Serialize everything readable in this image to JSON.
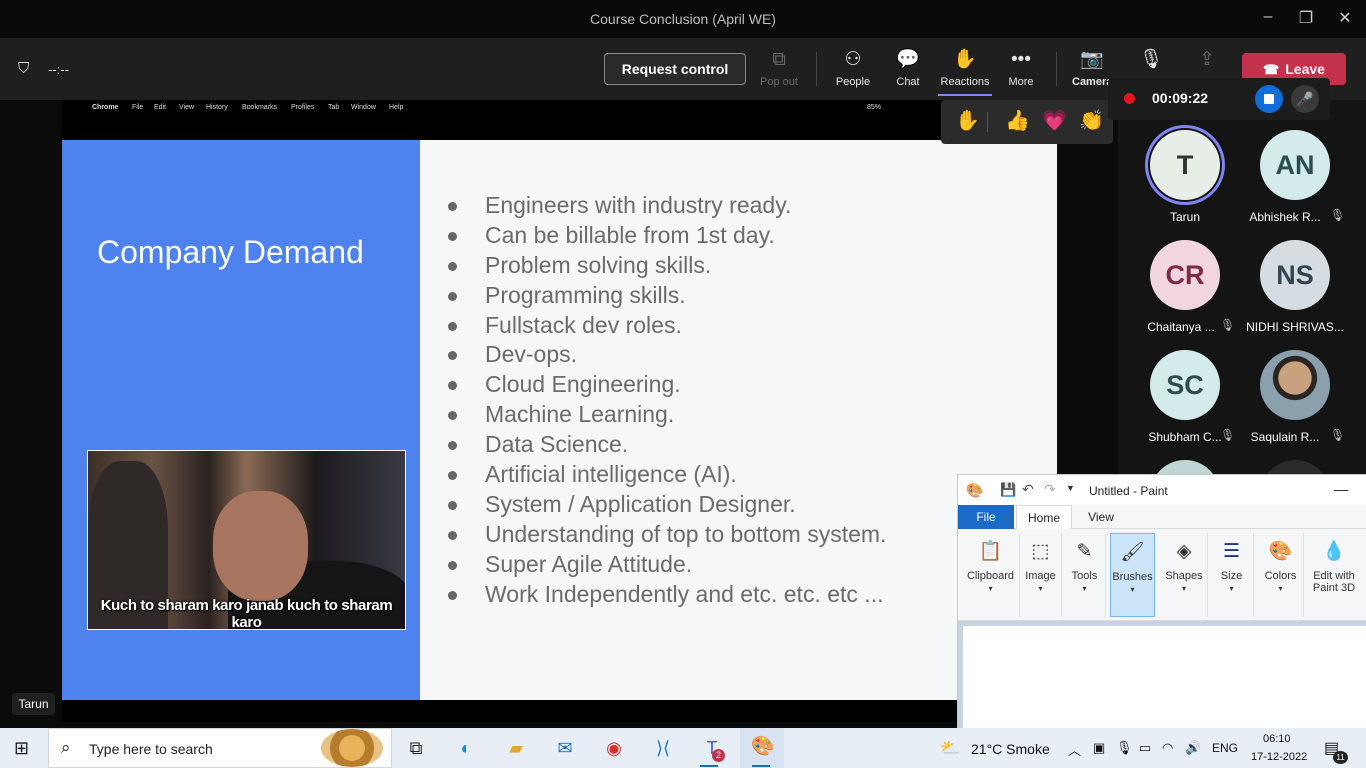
{
  "window": {
    "title": "Course Conclusion (April WE)",
    "controls": [
      "–",
      "❐",
      "✕"
    ]
  },
  "toolbar": {
    "timer": "--:--",
    "request_control": "Request control",
    "popout": "Pop out",
    "people": "People",
    "chat": "Chat",
    "reactions": "Reactions",
    "more": "More",
    "camera": "Camera",
    "leave": "Leave"
  },
  "recording": {
    "time": "00:09:22"
  },
  "reactions_popup": [
    "✋",
    "👍",
    "💗",
    "👏",
    "😆",
    "😮"
  ],
  "mac_menu": [
    "Chrome",
    "File",
    "Edit",
    "View",
    "History",
    "Bookmarks",
    "Profiles",
    "Tab",
    "Window",
    "Help"
  ],
  "mac_status": "85%",
  "slide": {
    "title": "Company Demand",
    "meme_caption": "Kuch to sharam karo janab kuch to sharam karo",
    "bullets": [
      "Engineers with industry ready.",
      "Can be billable from 1st day.",
      "Problem solving skills.",
      "Programming skills.",
      "Fullstack dev roles.",
      "Dev-ops.",
      "Cloud Engineering.",
      "Machine Learning.",
      "Data Science.",
      "Artificial intelligence (AI).",
      "System / Application Designer.",
      "Understanding of top to bottom system.",
      "Super Agile Attitude.",
      "Work Independently and etc. etc. etc ..."
    ]
  },
  "presenter_tag": "Tarun",
  "participants": [
    {
      "initials": "T",
      "name": "Tarun"
    },
    {
      "initials": "AN",
      "name": "Abhishek R..."
    },
    {
      "initials": "CR",
      "name": "Chaitanya ..."
    },
    {
      "initials": "NS",
      "name": "NIDHI SHRIVAS..."
    },
    {
      "initials": "SC",
      "name": "Shubham C..."
    },
    {
      "initials": "",
      "name": "Saqulain R..."
    }
  ],
  "paint": {
    "title": "Untitled - Paint",
    "tabs": [
      "File",
      "Home",
      "View"
    ],
    "groups": [
      "Clipboard",
      "Image",
      "Tools",
      "Brushes",
      "Shapes",
      "Size",
      "Colors",
      "Edit with Paint 3D"
    ]
  },
  "taskbar": {
    "search_placeholder": "Type here to search",
    "weather": "21°C  Smoke",
    "lang": "ENG",
    "time": "06:10",
    "date": "17-12-2022",
    "teams_badge": "2",
    "notif_count": "11"
  },
  "colors": {
    "slide_blue": "#4e82ee",
    "leave_red": "#c4314b",
    "accent": "#7f85f5"
  }
}
